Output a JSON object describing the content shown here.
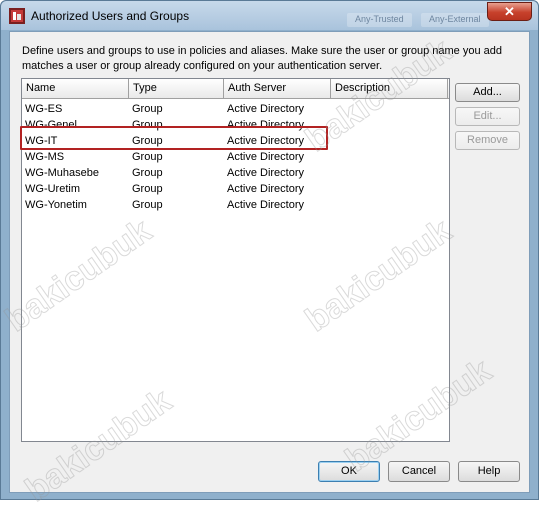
{
  "window": {
    "title": "Authorized Users and Groups",
    "close_label": "✕",
    "background_tabs": [
      "Any-Trusted",
      "Any-External"
    ]
  },
  "description": "Define users and groups to use in policies and aliases. Make sure the user or group name you add matches a user or group already configured on your authentication server.",
  "table": {
    "columns": [
      "Name",
      "Type",
      "Auth Server",
      "Description"
    ],
    "rows": [
      {
        "name": "WG-ES",
        "type": "Group",
        "auth_server": "Active Directory",
        "description": ""
      },
      {
        "name": "WG-Genel",
        "type": "Group",
        "auth_server": "Active Directory",
        "description": ""
      },
      {
        "name": "WG-IT",
        "type": "Group",
        "auth_server": "Active Directory",
        "description": ""
      },
      {
        "name": "WG-MS",
        "type": "Group",
        "auth_server": "Active Directory",
        "description": ""
      },
      {
        "name": "WG-Muhasebe",
        "type": "Group",
        "auth_server": "Active Directory",
        "description": ""
      },
      {
        "name": "WG-Uretim",
        "type": "Group",
        "auth_server": "Active Directory",
        "description": ""
      },
      {
        "name": "WG-Yonetim",
        "type": "Group",
        "auth_server": "Active Directory",
        "description": ""
      }
    ],
    "highlighted_row": "WG-IT"
  },
  "side_buttons": {
    "add": "Add...",
    "edit": "Edit...",
    "remove": "Remove"
  },
  "footer_buttons": {
    "ok": "OK",
    "cancel": "Cancel",
    "help": "Help"
  },
  "watermark": "bakicubuk",
  "colors": {
    "highlight": "#b22222",
    "title_bar": "#a9c3dc",
    "close": "#c7412c"
  }
}
